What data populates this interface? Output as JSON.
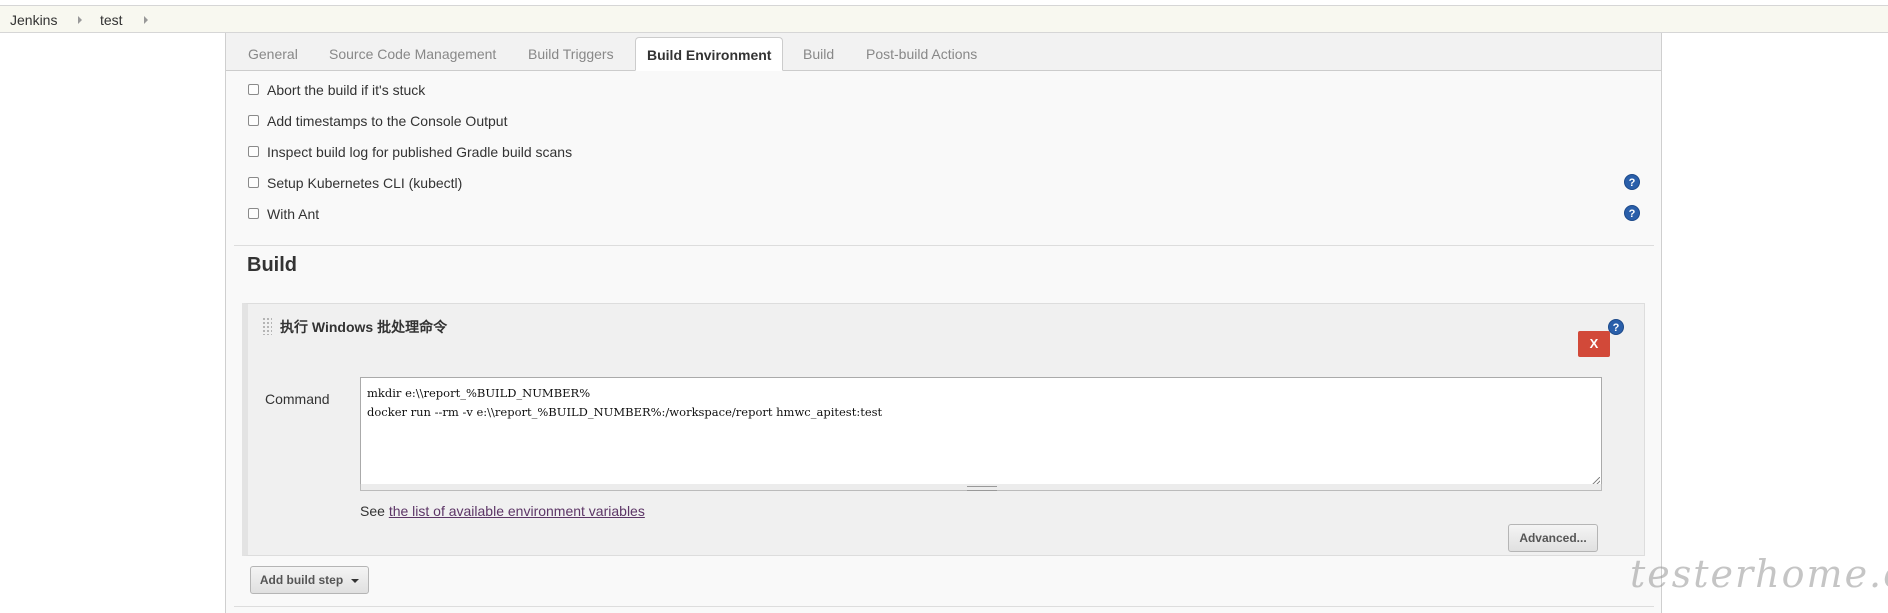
{
  "breadcrumb": {
    "items": [
      "Jenkins",
      "test"
    ]
  },
  "tabs": [
    "General",
    "Source Code Management",
    "Build Triggers",
    "Build Environment",
    "Build",
    "Post-build Actions"
  ],
  "active_tab": "Build Environment",
  "build_environment": {
    "options": [
      {
        "label": "Abort the build if it's stuck",
        "checked": false
      },
      {
        "label": "Add timestamps to the Console Output",
        "checked": false
      },
      {
        "label": "Inspect build log for published Gradle build scans",
        "checked": false
      },
      {
        "label": "Setup Kubernetes CLI (kubectl)",
        "checked": false,
        "help": true
      },
      {
        "label": "With Ant",
        "checked": false,
        "help": true
      }
    ]
  },
  "build": {
    "title": "Build",
    "step": {
      "title": "执行 Windows 批处理命令",
      "delete_label": "X",
      "command_label": "Command",
      "command_value": "mkdir e:\\\\report_%BUILD_NUMBER%\ndocker run --rm -v e:\\\\report_%BUILD_NUMBER%:/workspace/report hmwc_apitest:test",
      "see_text": "See ",
      "see_link": "the list of available environment variables",
      "advanced_label": "Advanced..."
    },
    "add_step_label": "Add build step"
  },
  "help_glyph": "?",
  "watermark": "testerhome.com"
}
